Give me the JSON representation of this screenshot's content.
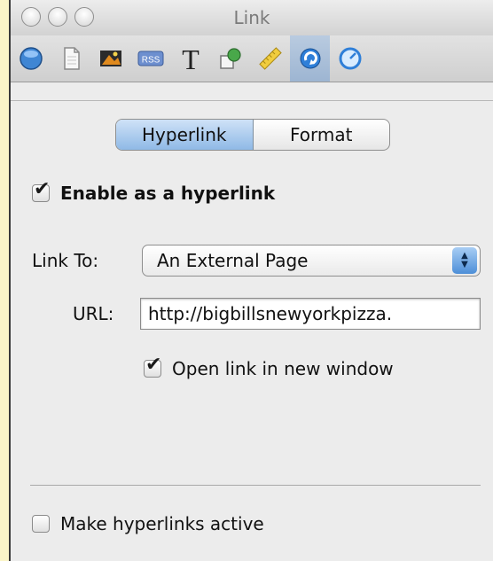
{
  "window": {
    "title": "Link"
  },
  "toolbar": {
    "items": [
      {
        "name": "site-inspector-icon"
      },
      {
        "name": "page-inspector-icon"
      },
      {
        "name": "photo-inspector-icon"
      },
      {
        "name": "rss-inspector-icon",
        "label": "RSS"
      },
      {
        "name": "text-inspector-icon",
        "label": "T"
      },
      {
        "name": "graphic-inspector-icon"
      },
      {
        "name": "metrics-inspector-icon"
      },
      {
        "name": "link-inspector-icon",
        "selected": true
      },
      {
        "name": "quicktime-inspector-icon"
      }
    ]
  },
  "tabs": {
    "hyperlink": "Hyperlink",
    "format": "Format",
    "active": "Hyperlink"
  },
  "enable": {
    "label": "Enable as a hyperlink",
    "checked": true
  },
  "link_to": {
    "label": "Link To:",
    "value": "An External Page"
  },
  "url": {
    "label": "URL:",
    "value": "http://bigbillsnewyorkpizza."
  },
  "new_window": {
    "label": "Open link in new window",
    "checked": true
  },
  "make_active": {
    "label": "Make hyperlinks active",
    "checked": false
  },
  "colors": {
    "accent": "#8fb9e6",
    "background": "#ececec",
    "outer": "#fbf5c8"
  }
}
